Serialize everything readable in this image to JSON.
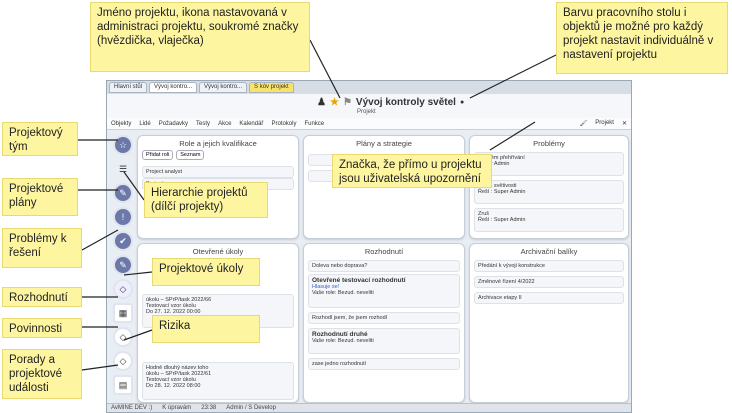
{
  "callouts": {
    "project_name": "Jméno projektu, ikona nastavovaná v administraci projektu, soukromé značky (hvězdička, vlaječka)",
    "desk_color": "Barvu pracovního stolu i objektů je možné pro každý projekt nastavit individuálně v nastavení projektu",
    "team": "Projektový tým",
    "plans": "Projektové plány",
    "problems": "Problémy k řešení",
    "decisions": "Rozhodnutí",
    "duties": "Povinnosti",
    "meetings": "Porady a projektové události",
    "hierarchy": "Hierarchie projektů (dílčí projekty)",
    "tasks": "Projektové úkoly",
    "risks": "Rizika",
    "notice_mark": "Značka, že přímo u projektu jsou uživatelská upozornění"
  },
  "tabs": [
    "Hlavní stůl",
    "Vývoj kontro...",
    "Vývoj kontro...",
    "S kóv projekt"
  ],
  "project": {
    "title": "Vývoj kontroly světel",
    "subtitle": "Projekt"
  },
  "menu": [
    "Objekty",
    "Lidé",
    "Požadavky",
    "Testy",
    "Akce",
    "Kalendář",
    "Protokoly",
    "Funkce"
  ],
  "menu_right": "Projekt",
  "cards": {
    "roles": {
      "title": "Role a jejich kvalifikace",
      "btn1": "Přidat roli",
      "btn2": "Seznam",
      "item1": "Project analyst",
      "item2": "Project manager"
    },
    "plans": {
      "title": "Plány a strategie"
    },
    "problems": {
      "title": "Problémy",
      "p1": "Prostém přehřívání",
      "p1u": "Super Admin",
      "p2": "Ztráta světivosti",
      "p2u": "Řeší : Super Admin",
      "p3": "Zruš",
      "p3u": "Řeší : Super Admin"
    },
    "tasks": {
      "title": "Otevřené úkoly",
      "t1": "úkolu – SPrP/task 2022/66",
      "t1b": "Testovací vzor úkolu",
      "t1d": "Do 27. 12. 2022 00:00",
      "t2": "Hodně dlouhý název toho",
      "t3": "úkolu – SPrP/task 2022/61",
      "t3b": "Testovací vzor úkolu",
      "t3d": "Do 28. 12. 2022 08:00"
    },
    "decisions": {
      "title": "Rozhodnutí",
      "d1": "Doleva nebo doprava?",
      "d2": "Otevřené testovací rozhodnutí",
      "d2a": "Hlasuje se!",
      "d2b": "Vaše role:",
      "d2c": "Bezud. neveliti",
      "d3": "Rozhodl jsem, že jsem rozhodl",
      "d4": "Rozhodnutí druhé",
      "d4b": "Vaše role:",
      "d4c": "Bezud. neveliti",
      "d5": "zase jedno rozhodnutí"
    },
    "archive": {
      "title": "Archivační balíky",
      "a1": "Předání k vývoji konstrukce",
      "a2": "Změnové řízení 4/2022",
      "a3": "Archivace etapy II"
    }
  },
  "status": [
    "AvMINE DEV :)",
    "K úpravám",
    "23:38",
    "Admin / S Develop"
  ],
  "colors": {
    "callout": "#fdf5a0",
    "accent": "#6b78a8",
    "card_border": "#c6ced8"
  }
}
